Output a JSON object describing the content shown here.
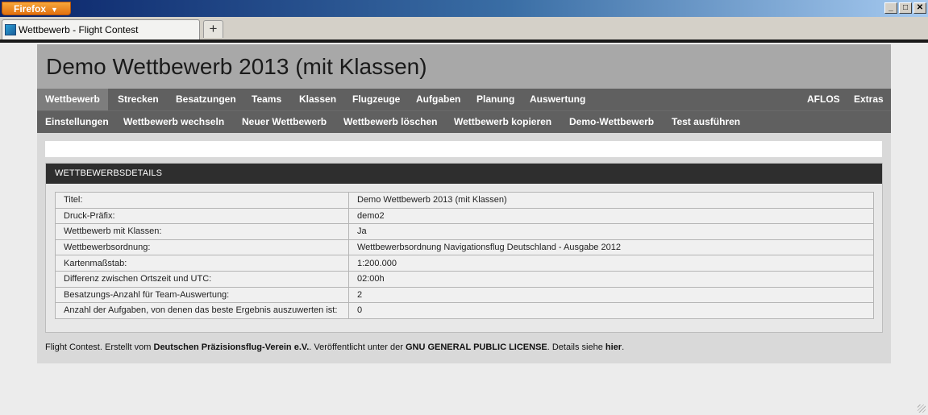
{
  "browser": {
    "menu_button": "Firefox",
    "tab_title": "Wettbewerb - Flight Contest",
    "new_tab": "+",
    "window_buttons": [
      "_",
      "□",
      "✕"
    ]
  },
  "page": {
    "title": "Demo Wettbewerb 2013 (mit Klassen)",
    "nav_main": [
      "Wettbewerb",
      "Strecken",
      "Besatzungen",
      "Teams",
      "Klassen",
      "Flugzeuge",
      "Aufgaben",
      "Planung",
      "Auswertung"
    ],
    "nav_right": [
      "AFLOS",
      "Extras"
    ],
    "nav_sub": [
      "Einstellungen",
      "Wettbewerb wechseln",
      "Neuer Wettbewerb",
      "Wettbewerb löschen",
      "Wettbewerb kopieren",
      "Demo-Wettbewerb",
      "Test ausführen"
    ],
    "panel_title": "WETTBEWERBSDETAILS",
    "details": [
      {
        "label": "Titel:",
        "value": "Demo Wettbewerb 2013 (mit Klassen)"
      },
      {
        "label": "Druck-Präfix:",
        "value": "demo2"
      },
      {
        "label": "Wettbewerb mit Klassen:",
        "value": "Ja"
      },
      {
        "label": "Wettbewerbsordnung:",
        "value": "Wettbewerbsordnung Navigationsflug Deutschland - Ausgabe 2012"
      },
      {
        "label": "Kartenmaßstab:",
        "value": "1:200.000"
      },
      {
        "label": "Differenz zwischen Ortszeit und UTC:",
        "value": "02:00h"
      },
      {
        "label": "Besatzungs-Anzahl für Team-Auswertung:",
        "value": "2"
      },
      {
        "label": "Anzahl der Aufgaben, von denen das beste Ergebnis auszuwerten ist:",
        "value": "0"
      }
    ],
    "footer": {
      "t1": "Flight Contest. Erstellt vom ",
      "org": "Deutschen Präzisionsflug-Verein e.V.",
      "t2": ". Veröffentlicht unter der ",
      "license": "GNU GENERAL PUBLIC LICENSE",
      "t3": ". Details siehe ",
      "link": "hier",
      "t4": "."
    }
  }
}
